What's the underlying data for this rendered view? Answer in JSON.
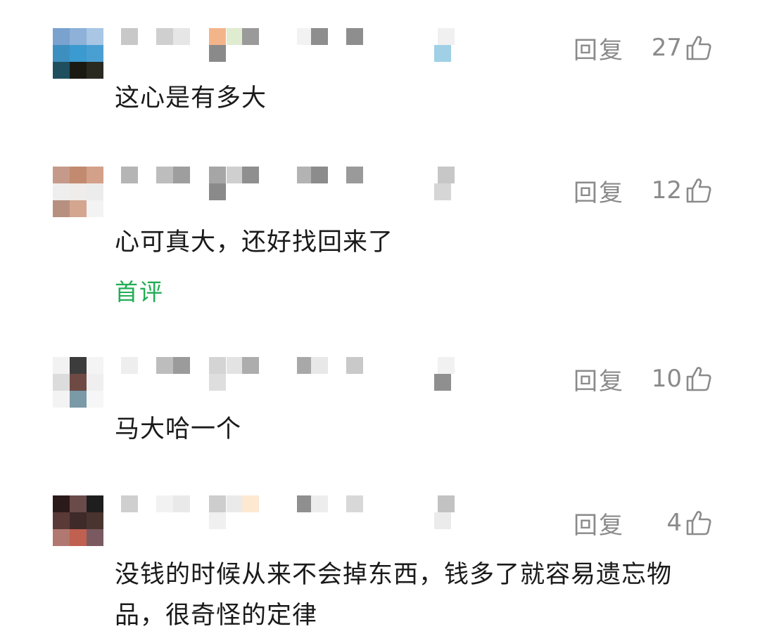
{
  "comments": [
    {
      "reply_label": "回复",
      "likes": "27",
      "text": "这心是有多大",
      "avatar_colors": [
        "#7aa2cf",
        "#8db1d8",
        "#a9c6e4",
        "#3d8fbf",
        "#3b9ad0",
        "#4a9fd2",
        "#1f4f5f",
        "#1a1a12",
        "#2a2a20"
      ],
      "nickname_colors": [
        "#c8c8c8",
        "#cfcfcf",
        "#e6e6e6",
        "#f4b48a",
        "#e0ecd0",
        "#9a9a9a",
        "#f2f2f2",
        "#8e8e8e",
        "#8e8e8e",
        "#f0f0f0",
        "#8a8a8a",
        "#9fd0e6"
      ],
      "first_comment_label": ""
    },
    {
      "reply_label": "回复",
      "likes": "12",
      "text": "心可真大，还好找回来了",
      "avatar_colors": [
        "#c59a8a",
        "#c28a6e",
        "#d3a08a",
        "#eeeeee",
        "#f0ecea",
        "#ececec",
        "#b7907f",
        "#d4a690",
        "#f3f3f3"
      ],
      "nickname_colors": [
        "#b5b5b5",
        "#bdbdbd",
        "#9e9e9e",
        "#a6a6a6",
        "#cfcfcf",
        "#8f8f8f",
        "#b3b3b3",
        "#8c8c8c",
        "#9a9a9a",
        "#c7c7c7",
        "#8a8a8a",
        "#d6d6d6"
      ],
      "first_comment_label": "首评"
    },
    {
      "reply_label": "回复",
      "likes": "10",
      "text": "马大哈一个",
      "avatar_colors": [
        "#f2f2f2",
        "#3c3c3c",
        "#f4f4f4",
        "#dcdcdc",
        "#6f4a45",
        "#efefef",
        "#f3f3f3",
        "#7a9aa8",
        "#f6f6f6"
      ],
      "nickname_colors": [
        "#eeeeee",
        "#bdbdbd",
        "#9b9b9b",
        "#d4d4d4",
        "#e3e3e3",
        "#adadad",
        "#a8a8a8",
        "#e8e8e8",
        "#c9c9c9",
        "#f1f1f1",
        "#dedede",
        "#8f8f8f"
      ],
      "first_comment_label": ""
    },
    {
      "reply_label": "回复",
      "likes": "4",
      "text": "没钱的时候从来不会掉东西，钱多了就容易遗忘物品，很奇怪的定律",
      "avatar_colors": [
        "#2b1a1a",
        "#6b4a4a",
        "#1e1e1e",
        "#5a3a36",
        "#3e2a28",
        "#4a3430",
        "#b07870",
        "#c06050",
        "#7a5a60"
      ],
      "nickname_colors": [
        "#cfcfcf",
        "#f2f2f2",
        "#e9e9e9",
        "#cdcdcd",
        "#eaeaea",
        "#fde8d2",
        "#8f8f8f",
        "#ededed",
        "#d8d8d8",
        "#c2c2c2",
        "#f0f0f0",
        "#ebebeb"
      ],
      "first_comment_label": ""
    }
  ]
}
